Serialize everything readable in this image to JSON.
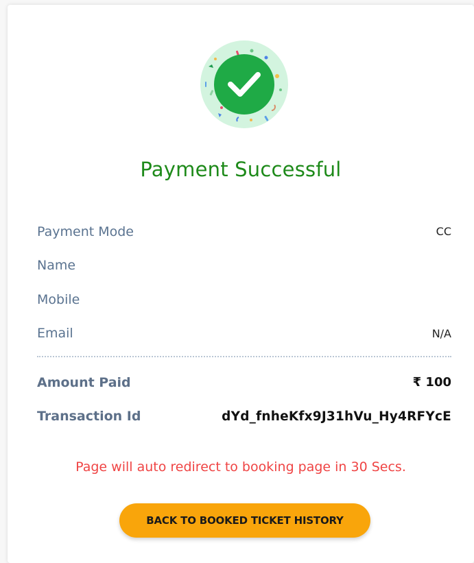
{
  "status": {
    "title": "Payment Successful",
    "icon": "check-circle-icon",
    "success_color": "#1e8a1a"
  },
  "details": [
    {
      "label": "Payment Mode",
      "value": "CC"
    },
    {
      "label": "Name",
      "value": ""
    },
    {
      "label": "Mobile",
      "value": ""
    },
    {
      "label": "Email",
      "value": "N/A"
    }
  ],
  "summary": {
    "amount_label": "Amount Paid",
    "amount_value": "₹ 100",
    "transaction_label": "Transaction Id",
    "transaction_value": "dYd_fnheKfx9J31hVu_Hy4RFYcE"
  },
  "redirect_message": "Page will auto redirect to booking page in 30 Secs.",
  "redirect_color": "#ef4444",
  "action": {
    "label": "BACK TO BOOKED TICKET HISTORY",
    "color": "#f9a50b"
  }
}
